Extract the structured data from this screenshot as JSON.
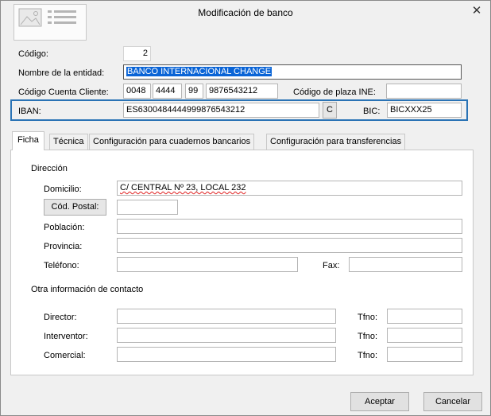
{
  "window": {
    "title": "Modificación de banco"
  },
  "header": {
    "codigo_label": "Código:",
    "codigo_value": "2",
    "entidad_label": "Nombre de la entidad:",
    "entidad_value": "BANCO INTERNACIONAL CHANGE",
    "ccc_label": "Código Cuenta Cliente:",
    "ccc": {
      "entidad": "0048",
      "oficina": "4444",
      "dc": "99",
      "cuenta": "9876543212"
    },
    "plaza_label": "Código de plaza INE:",
    "plaza_value": "",
    "iban_label": "IBAN:",
    "iban_value": "ES6300484444999876543212",
    "iban_calc_button": "C",
    "bic_label": "BIC:",
    "bic_value": "BICXXX25"
  },
  "tabs": [
    {
      "label": "Ficha",
      "active": true
    },
    {
      "label": "Técnica",
      "active": false
    },
    {
      "label": "Configuración para cuadernos bancarios",
      "active": false
    },
    {
      "label": "Configuración para transferencias",
      "active": false
    }
  ],
  "ficha": {
    "direccion_title": "Dirección",
    "domicilio_label": "Domicilio:",
    "domicilio_value": "C/ CENTRAL Nº 23, LOCAL 232",
    "cp_button": "Cód. Postal:",
    "cp_value": "",
    "poblacion_label": "Población:",
    "poblacion_value": "",
    "provincia_label": "Provincia:",
    "provincia_value": "",
    "telefono_label": "Teléfono:",
    "telefono_value": "",
    "fax_label": "Fax:",
    "fax_value": "",
    "contacto_title": "Otra información de contacto",
    "director_label": "Director:",
    "director_value": "",
    "director_tfno_label": "Tfno:",
    "director_tfno_value": "",
    "interventor_label": "Interventor:",
    "interventor_value": "",
    "interventor_tfno_label": "Tfno:",
    "interventor_tfno_value": "",
    "comercial_label": "Comercial:",
    "comercial_value": "",
    "comercial_tfno_label": "Tfno:",
    "comercial_tfno_value": ""
  },
  "footer": {
    "accept": "Aceptar",
    "cancel": "Cancelar"
  },
  "colors": {
    "selection": "#0a64d6",
    "iban_frame": "#2a73b5",
    "window_bg": "#f0f0f0"
  }
}
